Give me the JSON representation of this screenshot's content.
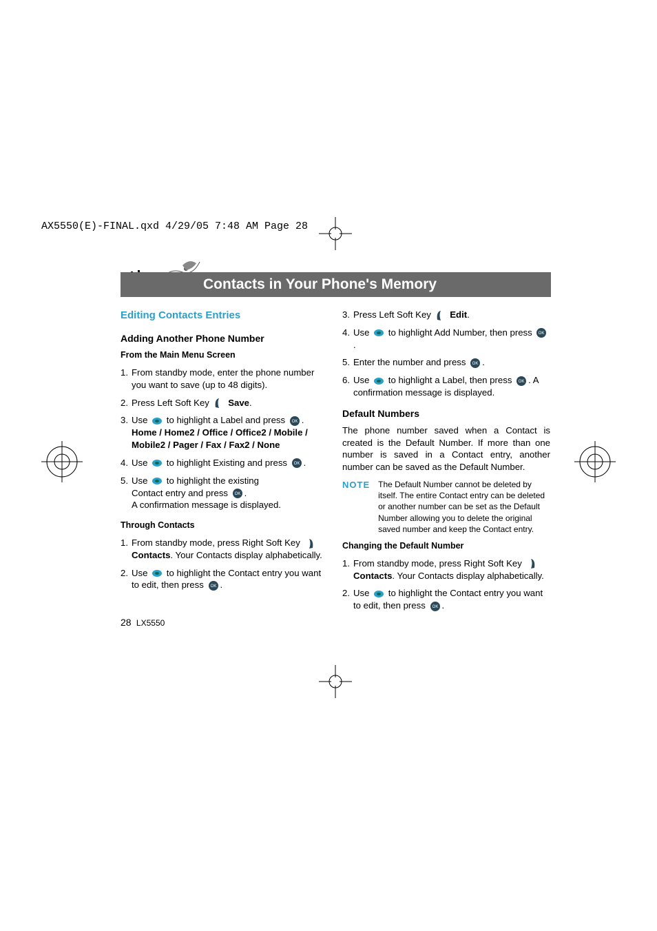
{
  "filepath": "AX5550(E)-FINAL.qxd  4/29/05  7:48 AM  Page 28",
  "header_title": "Contacts in Your Phone's Memory",
  "left": {
    "section_title": "Editing Contacts Entries",
    "sub1": "Adding Another Phone Number",
    "sub1a": "From the Main Menu Screen",
    "s1": "From standby mode, enter the phone number you want to save (up to 48 digits).",
    "s2a": "Press Left Soft Key ",
    "s2b": "Save",
    "s3a": "Use ",
    "s3b": " to highlight a Label and press ",
    "s3labels": "Home / Home2 / Office / Office2 / Mobile / Mobile2 / Pager / Fax / Fax2 / None",
    "s4a": "Use ",
    "s4b": " to highlight Existing and press ",
    "s5a": "Use ",
    "s5b": " to highlight the existing",
    "s5c": "Contact entry and press ",
    "s5d": "A confirmation message is displayed.",
    "sub1b": "Through Contacts",
    "t1a": "From standby mode, press Right Soft Key ",
    "t1b": "Contacts",
    "t1c": "Your Contacts display alphabetically.",
    "t2a": "Use ",
    "t2b": " to highlight the Contact entry you want to edit, then press "
  },
  "right": {
    "r3a": "Press Left Soft Key ",
    "r3b": "Edit",
    "r4a": "Use ",
    "r4b": " to highlight Add Number, then press ",
    "r5a": "Enter the number and press ",
    "r6a": "Use ",
    "r6b": " to highlight a Label, then press ",
    "r6c": "A confirmation message is displayed.",
    "sub2": "Default Numbers",
    "para1": "The phone number saved when a Contact is created is the Default Number. If more than one number is saved in a Contact entry, another number can be saved as the Default Number.",
    "note_label": "NOTE",
    "note_text": "The Default Number cannot be deleted by itself. The entire Contact entry can be deleted or another number can be set as the Default Number allowing you to delete the original saved number and keep the Contact entry.",
    "sub2a": "Changing the Default Number",
    "c1a": "From standby mode, press Right Soft Key ",
    "c1b": "Contacts",
    "c1c": "Your Contacts display alphabetically.",
    "c2a": "Use ",
    "c2b": " to highlight the Contact entry you want to edit, then press "
  },
  "footer": {
    "page": "28",
    "model": "LX5550"
  }
}
